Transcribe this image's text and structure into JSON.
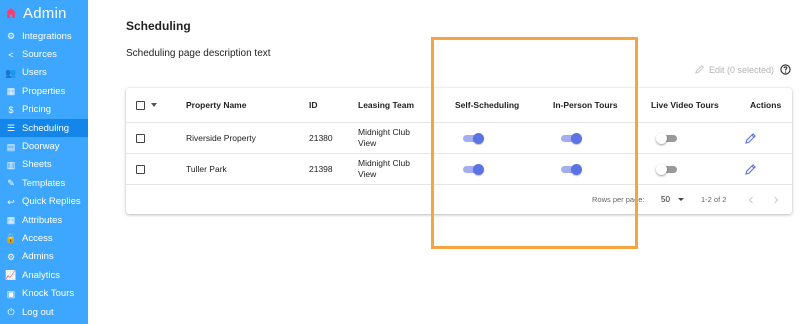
{
  "sidebar": {
    "brand_title": "Admin",
    "items": [
      {
        "label": "Integrations",
        "icon": "integrations-icon",
        "glyph": "⚙"
      },
      {
        "label": "Sources",
        "icon": "share-icon",
        "glyph": "<"
      },
      {
        "label": "Users",
        "icon": "users-icon",
        "glyph": "👥"
      },
      {
        "label": "Properties",
        "icon": "building-icon",
        "glyph": "▦"
      },
      {
        "label": "Pricing",
        "icon": "dollar-icon",
        "glyph": "$"
      },
      {
        "label": "Scheduling",
        "icon": "sliders-icon",
        "glyph": "☰"
      },
      {
        "label": "Doorway",
        "icon": "calendar-icon",
        "glyph": "▤"
      },
      {
        "label": "Sheets",
        "icon": "sheets-icon",
        "glyph": "▥"
      },
      {
        "label": "Templates",
        "icon": "template-edit-icon",
        "glyph": "✎"
      },
      {
        "label": "Quick Replies",
        "icon": "reply-icon",
        "glyph": "↩"
      },
      {
        "label": "Attributes",
        "icon": "table-icon",
        "glyph": "▦"
      },
      {
        "label": "Access",
        "icon": "lock-icon",
        "glyph": "🔒"
      },
      {
        "label": "Admins",
        "icon": "admins-icon",
        "glyph": "⚙"
      },
      {
        "label": "Analytics",
        "icon": "analytics-icon",
        "glyph": "📈"
      },
      {
        "label": "Knock Tours",
        "icon": "book-icon",
        "glyph": "▣"
      },
      {
        "label": "Log out",
        "icon": "power-icon",
        "glyph": "⏻"
      }
    ],
    "active_index": 5
  },
  "page": {
    "title": "Scheduling",
    "description": "Scheduling page description text",
    "edit_selected_label": "Edit (0 selected)"
  },
  "table": {
    "headers": {
      "property_name": "Property Name",
      "id": "ID",
      "leasing_team": "Leasing Team",
      "self_scheduling": "Self-Scheduling",
      "in_person_tours": "In-Person Tours",
      "live_video_tours": "Live Video Tours",
      "actions": "Actions"
    },
    "rows": [
      {
        "property_name": "Riverside Property",
        "id": "21380",
        "leasing_team_line1": "Midnight Club",
        "leasing_team_line2": "View",
        "self_scheduling": true,
        "in_person_tours": true,
        "live_video_tours": false
      },
      {
        "property_name": "Tuller Park",
        "id": "21398",
        "leasing_team_line1": "Midnight Club",
        "leasing_team_line2": "View",
        "self_scheduling": true,
        "in_person_tours": true,
        "live_video_tours": false
      }
    ],
    "footer": {
      "rows_per_page_label": "Rows per page:",
      "rows_per_page_value": "50",
      "range_text": "1-2 of 2"
    }
  },
  "colors": {
    "sidebar_bg": "#3da7ff",
    "sidebar_active": "#1486ea",
    "toggle_on": "#5c73e6",
    "highlight": "#f4a542"
  }
}
